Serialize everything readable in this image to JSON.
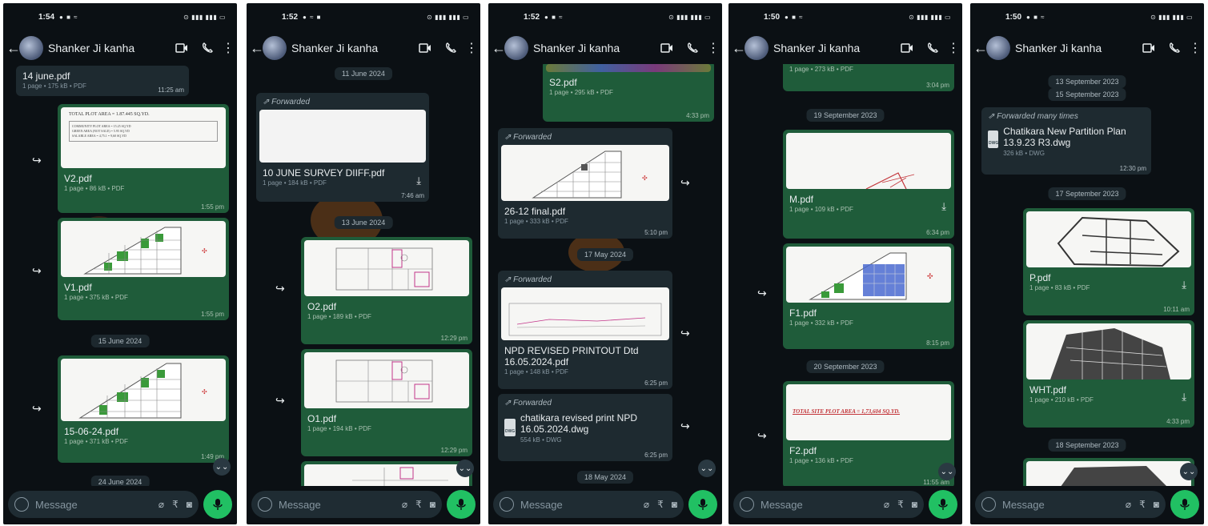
{
  "contact_name": "Shanker Ji kanha",
  "input_placeholder": "Message",
  "screens": [
    {
      "time": "1:54",
      "messages": {
        "m1": {
          "name": "14 june.pdf",
          "meta": "1 page • 175 kB • PDF",
          "time": "11:25 am"
        },
        "m2": {
          "name": "V2.pdf",
          "meta": "1 page • 86 kB • PDF",
          "time": "1:55 pm",
          "thumb_line1": "TOTAL PLOT AREA = 1.87.445 SQ.YD.",
          "thumb_line2": "COMMUNITY PLOT AREA = 15.25 SQ.YD",
          "thumb_line3": "GREEN AREA (NOT SALE) = 5.95 SQ.YD",
          "thumb_line4": "SALABLE AREA = 4,75.1 = 9,60 SQ.YD"
        },
        "m3": {
          "name": "V1.pdf",
          "meta": "1 page • 375 kB • PDF",
          "time": "1:55 pm"
        },
        "m4": {
          "name": "15-06-24.pdf",
          "meta": "1 page • 371 kB • PDF",
          "time": "1:49 pm"
        }
      },
      "dates": {
        "d1": "15 June 2024",
        "d2": "24 June 2024"
      }
    },
    {
      "time": "1:52",
      "messages": {
        "m1": {
          "forwarded": "Forwarded",
          "name": "10 JUNE SURVEY DIIFF.pdf",
          "meta": "1 page • 184 kB • PDF",
          "time": "7:46 am"
        },
        "m2": {
          "name": "O2.pdf",
          "meta": "1 page • 189 kB • PDF",
          "time": "12:29 pm"
        },
        "m3": {
          "name": "O1.pdf",
          "meta": "1 page • 194 kB • PDF",
          "time": "12:29 pm"
        }
      },
      "dates": {
        "d0": "11 June 2024",
        "d1": "13 June 2024"
      }
    },
    {
      "time": "1:52",
      "messages": {
        "m1": {
          "name": "S2.pdf",
          "meta": "1 page • 295 kB • PDF",
          "time": "4:33 pm"
        },
        "m2": {
          "forwarded": "Forwarded",
          "name": "26-12 final.pdf",
          "meta": "1 page • 333 kB • PDF",
          "time": "5:10 pm"
        },
        "m3": {
          "forwarded": "Forwarded",
          "name": "NPD REVISED PRINTOUT Dtd 16.05.2024.pdf",
          "meta": "1 page • 148 kB • PDF",
          "time": "6:25 pm"
        },
        "m4": {
          "forwarded": "Forwarded",
          "name": "chatikara revised print NPD 16.05.2024.dwg",
          "meta": "554 kB • DWG",
          "time": "6:25 pm"
        }
      },
      "dates": {
        "d1": "17 May 2024",
        "d2": "18 May 2024"
      }
    },
    {
      "time": "1:50",
      "messages": {
        "m0": {
          "meta": "1 page • 273 kB • PDF",
          "time": "3:04 pm"
        },
        "m1": {
          "name": "M.pdf",
          "meta": "1 page • 109 kB • PDF",
          "time": "6:34 pm"
        },
        "m2": {
          "name": "F1.pdf",
          "meta": "1 page • 332 kB • PDF",
          "time": "8:15 pm"
        },
        "m3": {
          "name": "F2.pdf",
          "meta": "1 page • 136 kB • PDF",
          "time": "11:55 am",
          "thumb_line1": "TOTAL SITE PLOT AREA = 1,73,604 SQ.YD."
        }
      },
      "dates": {
        "d1": "19 September 2023",
        "d2": "20 September 2023"
      }
    },
    {
      "time": "1:50",
      "messages": {
        "m1": {
          "forwarded": "Forwarded many times",
          "name": "Chatikara New Partition Plan 13.9.23 R3.dwg",
          "meta": "326 kB • DWG",
          "time": "12:30 pm"
        },
        "m2": {
          "name": "P.pdf",
          "meta": "1 page • 83 kB • PDF",
          "time": "10:11 am"
        },
        "m3": {
          "name": "WHT.pdf",
          "meta": "1 page • 210 kB • PDF",
          "time": "4:33 pm"
        }
      },
      "dates": {
        "d0": "13 September 2023",
        "d0b": "15 September 2023",
        "d1": "17 September 2023",
        "d2": "18 September 2023"
      }
    }
  ],
  "colors": {
    "outgoing": "#1f5c3a",
    "incoming": "#1e2a30",
    "accent": "#21c063",
    "background": "#0b1014"
  }
}
